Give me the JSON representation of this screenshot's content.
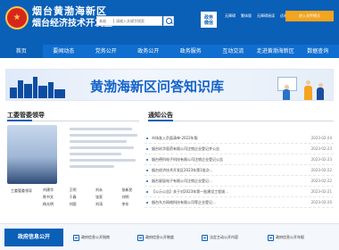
{
  "header": {
    "title_line1": "烟台黄渤海新区",
    "title_line2": "烟台经济技术开发区",
    "search": {
      "selected": "本站",
      "placeholder": "请输入关键字搜索"
    },
    "qr_label": "政务\n微信",
    "top_links": [
      "无障碍",
      "繁体版",
      "无障碍阅读",
      "适老模式"
    ],
    "badge": "进入关怀模式"
  },
  "nav": [
    "首页",
    "要闻动态",
    "党务公开",
    "政务公开",
    "政务服务",
    "互动交流",
    "走进黄渤海新区",
    "数据查询"
  ],
  "banner": {
    "text": "黄渤海新区问答知识库"
  },
  "leaders": {
    "title": "工委管委领导",
    "main_name": "工委管委领导",
    "names": [
      "刘建华",
      "王明",
      "刘永",
      "张新民",
      "陈书文",
      "于春",
      "张家",
      "刘明",
      "杨光明",
      "刘国",
      "刘涛",
      "李东"
    ]
  },
  "announcements": {
    "title": "通知公告",
    "items": [
      {
        "title": "市场准入负面清单-2022年版",
        "date": "2023-02-24"
      },
      {
        "title": "烟台玖华医药有限公司注销企业登记并公告",
        "date": "2023-02-23"
      },
      {
        "title": "烟台德科电子科技有限公司注销企业登记公告",
        "date": "2023-02-23"
      },
      {
        "title": "烟台经济技术开发区2023年第1批次...",
        "date": "2023-02-22"
      },
      {
        "title": "烟台星辰电子有限公司注销企业登记...",
        "date": "2023-02-22"
      },
      {
        "title": "【公示公告】关于对2023年第一批建设工程竣...",
        "date": "2023-02-21"
      },
      {
        "title": "烟台东方网络科技有限公司等企业登记...",
        "date": "2023-02-20"
      }
    ]
  },
  "bottom": {
    "main_tab": "政府信息公开",
    "tabs": [
      "政府信息公开指南",
      "政府信息公开制度",
      "法定主动公开内容",
      "政府信息公开年报"
    ]
  }
}
